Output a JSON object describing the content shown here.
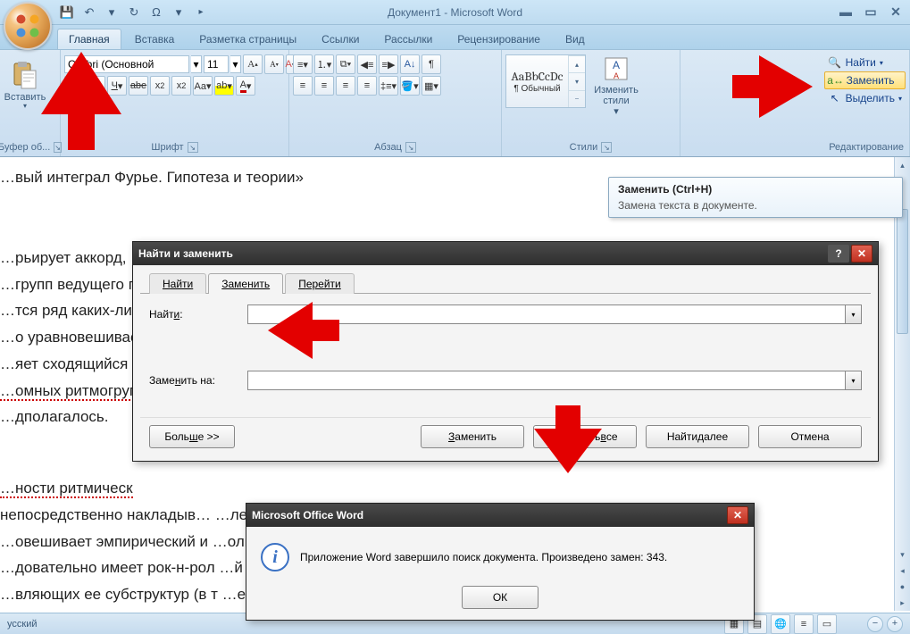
{
  "title": "Документ1 - Microsoft Word",
  "quickAccess": {
    "save": "💾",
    "undo": "↶",
    "redo": "↻",
    "sym": "Ω"
  },
  "tabs": [
    "Главная",
    "Вставка",
    "Разметка страницы",
    "Ссылки",
    "Рассылки",
    "Рецензирование",
    "Вид"
  ],
  "ribbon": {
    "clipboard": {
      "paste": "Вставить",
      "label": "Буфер об..."
    },
    "font": {
      "name": "Calibri (Основной",
      "size": "11",
      "label": "Шрифт"
    },
    "para": {
      "label": "Абзац"
    },
    "styles": {
      "preview": "AaBbCcDc",
      "item1": "¶ Обычный",
      "change": "Изменить\nстили",
      "label": "Стили"
    },
    "editing": {
      "find": "Найти",
      "replace": "Заменить",
      "select": "Выделить",
      "label": "Редактирование"
    }
  },
  "tooltip": {
    "title": "Заменить (Ctrl+H)",
    "body": "Замена текста в документе."
  },
  "doc": {
    "l1": "…вый интеграл Фурье. Гипотеза и теории»",
    "l2": "…рьирует аккорд,",
    "l3": "…групп ведущего го",
    "l4": "…тся ряд каких-ли",
    "l5": "…о уравновешивае",
    "l6": "…яет сходящийся р",
    "l7": "…омных ритмогруп",
    "l8": "…дполагалось.",
    "l9": "…ности ритмическ",
    "l10": "непосредственно накладыв…                                                                                         …лев в",
    "l11": "…овешивает эмпирический и                                                                                              …ольникам.",
    "l12": "…довательно имеет рок-н-рол                                                                                              …й ткани или",
    "l13": "…вляющих ее субструктур (в т                                                                                              …емповой)"
  },
  "status": {
    "lang": "усский"
  },
  "dlg": {
    "title": "Найти и заменить",
    "tab_find_pre": "",
    "tab_find_u": "Н",
    "tab_find_rest": "айти",
    "tab_replace_pre": "",
    "tab_replace_u": "З",
    "tab_replace_rest": "аменить",
    "tab_goto_pre": "",
    "tab_goto_u": "П",
    "tab_goto_rest": "ерейти",
    "lbl_find_pre": "Найт",
    "lbl_find_u": "и",
    "lbl_find_rest": ":",
    "lbl_repl_pre": "Заме",
    "lbl_repl_u": "н",
    "lbl_repl_rest": "ить на:",
    "find_value": "",
    "repl_value": "",
    "btn_more_pre": "Боль",
    "btn_more_u": "ш",
    "btn_more_rest": "е >>",
    "btn_replace_pre": "",
    "btn_replace_u": "З",
    "btn_replace_rest": "аменить",
    "btn_replaceall_pre": "Заменить ",
    "btn_replaceall_u": "в",
    "btn_replaceall_rest": "се",
    "btn_findnext_pre": "Найти ",
    "btn_findnext_u": "д",
    "btn_findnext_rest": "алее",
    "btn_cancel": "Отмена"
  },
  "msg": {
    "title": "Microsoft Office Word",
    "text": "Приложение Word завершило поиск документа. Произведено замен: 343.",
    "ok": "ОК"
  }
}
